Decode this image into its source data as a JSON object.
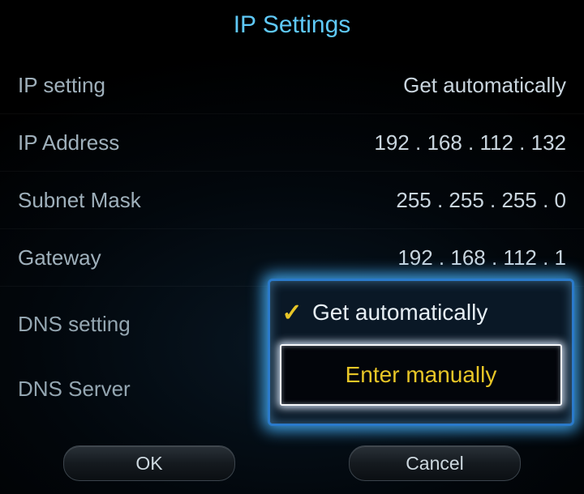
{
  "title": "IP Settings",
  "rows": {
    "ip_setting": {
      "label": "IP setting",
      "value": "Get automatically"
    },
    "ip_address": {
      "label": "IP Address",
      "value": "192 . 168 . 112 . 132"
    },
    "subnet_mask": {
      "label": "Subnet Mask",
      "value": "255 . 255 . 255 . 0"
    },
    "gateway": {
      "label": "Gateway",
      "value": "192 . 168 . 112 . 1"
    }
  },
  "dns": {
    "setting_label": "DNS setting",
    "server_label": "DNS Server",
    "dropdown": {
      "option_auto": "Get automatically",
      "option_manual": "Enter manually"
    }
  },
  "buttons": {
    "ok": "OK",
    "cancel": "Cancel"
  }
}
